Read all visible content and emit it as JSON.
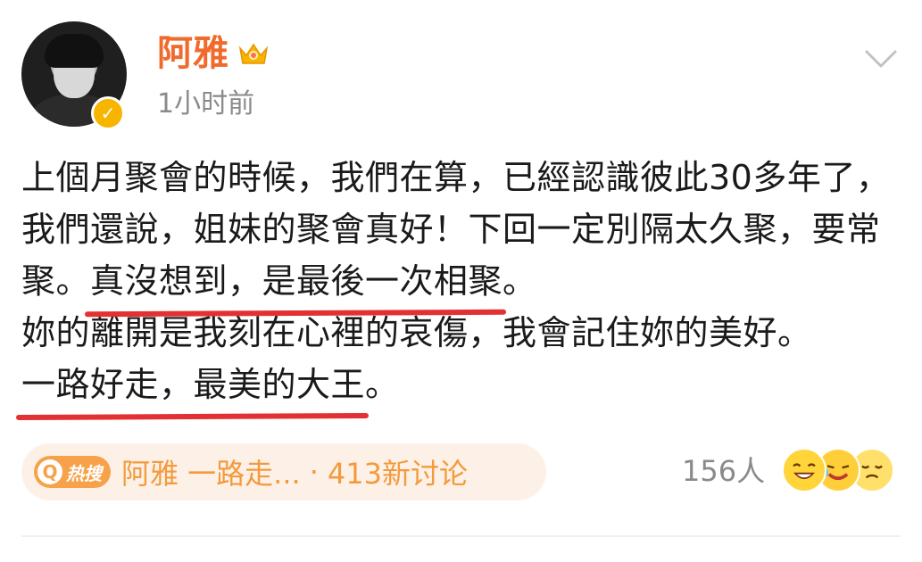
{
  "post": {
    "author": {
      "name": "阿雅",
      "time": "1小时前"
    },
    "text_segments": {
      "p1": "上個月聚會的時候，我們在算，已經認識彼此30多年了，我們還說，姐妹的聚會真好！下回一定別隔太久聚，要常聚。",
      "h1": "真沒想到，是最後一次相聚",
      "p2": "。\n妳的離開是我刻在心裡的哀傷，我會記住妳的美好。",
      "h2": "一路好走，最美的大王",
      "p3": "。"
    },
    "hot_search": {
      "badge": "热搜",
      "topic": "阿雅 一路走...",
      "separator": "·",
      "count": "413新讨论"
    },
    "reactions": {
      "count": "156人"
    }
  },
  "colors": {
    "username": "#f06a2b",
    "highlight_underline": "#e33032",
    "hot_search_bg": "#fdf1e7",
    "hot_search_text": "#f39a3d"
  }
}
